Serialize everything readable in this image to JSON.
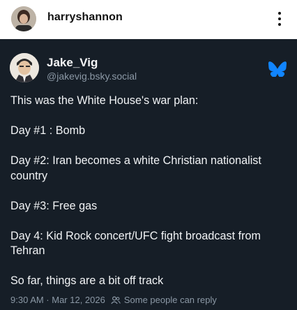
{
  "instagram": {
    "username": "harryshannon"
  },
  "post": {
    "author_name": "Jake_Vig",
    "author_handle": "@jakevig.bsky.social",
    "lines": [
      "This was the White House's war plan:",
      "Day #1 : Bomb",
      "Day #2: Iran becomes a white Christian nationalist country",
      "Day #3: Free gas",
      "Day 4: Kid Rock concert/UFC fight broadcast from Tehran",
      "So far, things are a bit off track"
    ],
    "timestamp": "9:30 AM · Mar 12, 2026",
    "reply_setting": "Some people can reply",
    "icons": {
      "logo": "bluesky-butterfly-icon",
      "reply": "people-icon",
      "menu": "more-vertical-icon"
    },
    "colors": {
      "background": "#161e27",
      "brand": "#1185fe",
      "muted": "#8b98a5"
    }
  }
}
